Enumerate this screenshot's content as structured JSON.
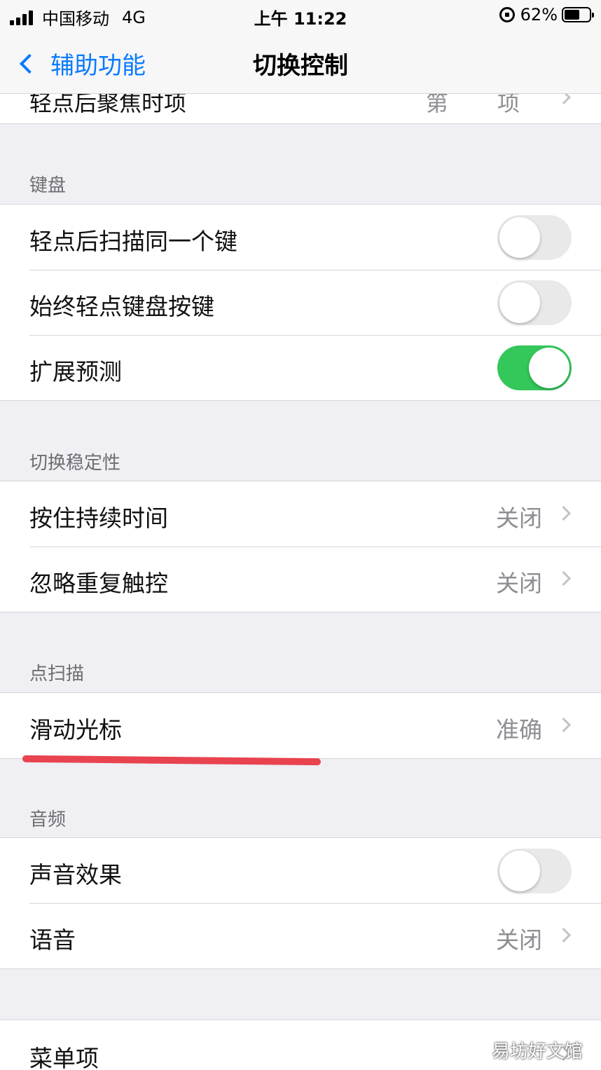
{
  "status_bar": {
    "carrier": "中国移动",
    "network": "4G",
    "time": "上午 11:22",
    "battery_percent": "62%",
    "battery_level": 0.62
  },
  "nav": {
    "back_label": "辅助功能",
    "title": "切换控制"
  },
  "partial_row": {
    "label": "轻点后聚焦时项",
    "value": "第 项"
  },
  "sections": {
    "keyboard": {
      "header": "键盘",
      "rows": [
        {
          "label": "轻点后扫描同一个键",
          "toggle_on": false
        },
        {
          "label": "始终轻点键盘按键",
          "toggle_on": false
        },
        {
          "label": "扩展预测",
          "toggle_on": true
        }
      ]
    },
    "stability": {
      "header": "切换稳定性",
      "rows": [
        {
          "label": "按住持续时间",
          "value": "关闭"
        },
        {
          "label": "忽略重复触控",
          "value": "关闭"
        }
      ]
    },
    "point_scan": {
      "header": "点扫描",
      "rows": [
        {
          "label": "滑动光标",
          "value": "准确"
        }
      ]
    },
    "audio": {
      "header": "音频",
      "rows": [
        {
          "label": "声音效果",
          "toggle_on": false
        },
        {
          "label": "语音",
          "value": "关闭"
        }
      ]
    },
    "menu": {
      "rows": [
        {
          "label": "菜单项"
        }
      ]
    }
  },
  "watermark": "易坊好文馆",
  "colors": {
    "accent": "#0a7aff",
    "toggle_on": "#34c759",
    "annotation": "#e8434f"
  }
}
